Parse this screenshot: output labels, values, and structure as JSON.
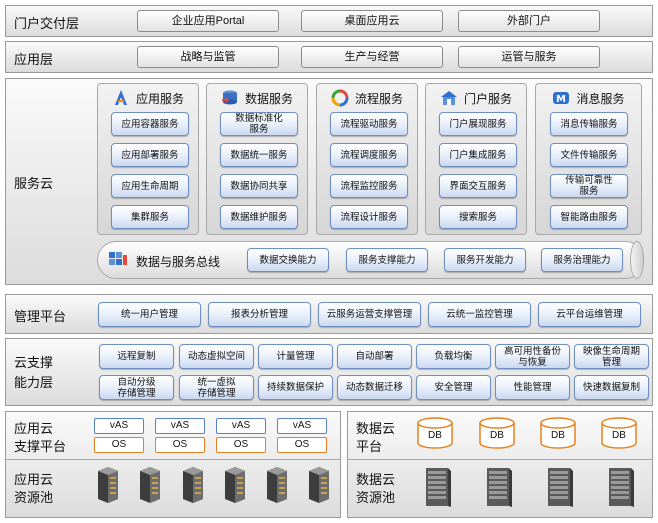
{
  "portal_layer": {
    "label": "门户交付层",
    "items": [
      "企业应用Portal",
      "桌面应用云",
      "外部门户"
    ]
  },
  "app_layer": {
    "label": "应用层",
    "items": [
      "战略与监管",
      "生产与经营",
      "运管与服务"
    ]
  },
  "service_cloud": {
    "label": "服务云",
    "panels": [
      {
        "title": "应用服务",
        "icon": "app-service-icon",
        "items": [
          "应用容器服务",
          "应用部署服务",
          "应用生命周期",
          "集群服务"
        ]
      },
      {
        "title": "数据服务",
        "icon": "data-service-icon",
        "items": [
          "数据标准化服务",
          "数据统一服务",
          "数据协同共享",
          "数据维护服务"
        ]
      },
      {
        "title": "流程服务",
        "icon": "process-service-icon",
        "items": [
          "流程驱动服务",
          "流程调度服务",
          "流程监控服务",
          "流程设计服务"
        ]
      },
      {
        "title": "门户服务",
        "icon": "portal-service-icon",
        "items": [
          "门户展现服务",
          "门户集成服务",
          "界面交互服务",
          "搜索服务"
        ]
      },
      {
        "title": "消息服务",
        "icon": "message-service-icon",
        "items": [
          "消息传输服务",
          "文件传输服务",
          "传输可靠性服务",
          "智能路由服务"
        ]
      }
    ],
    "bus": {
      "title": "数据与服务总线",
      "items": [
        "数据交换能力",
        "服务支撑能力",
        "服务开发能力",
        "服务治理能力"
      ]
    }
  },
  "management": {
    "label": "管理平台",
    "items": [
      "统一用户管理",
      "报表分析管理",
      "云服务运营支撑管理",
      "云统一监控管理",
      "云平台运维管理"
    ]
  },
  "cloud_support": {
    "label_line1": "云支撑",
    "label_line2": "能力层",
    "row1": [
      "远程复制",
      "动态虚拟空间",
      "计量管理",
      "自动部署",
      "负载均衡",
      "高可用性备份与恢复",
      "映像生命周期管理"
    ],
    "row2": [
      "自动分级存储管理",
      "统一虚拟存储管理",
      "持续数据保护",
      "动态数据迁移",
      "安全管理",
      "性能管理",
      "快速数据复制"
    ]
  },
  "app_cloud_support": {
    "label_line1": "应用云",
    "label_line2": "支撑平台",
    "vas_label": "vAS",
    "os_label": "OS"
  },
  "app_cloud_pool": {
    "label_line1": "应用云",
    "label_line2": "资源池"
  },
  "data_cloud_platform": {
    "label_line1": "数据云",
    "label_line2": "平台",
    "db_label": "DB"
  },
  "data_cloud_pool": {
    "label_line1": "数据云",
    "label_line2": "资源池"
  }
}
